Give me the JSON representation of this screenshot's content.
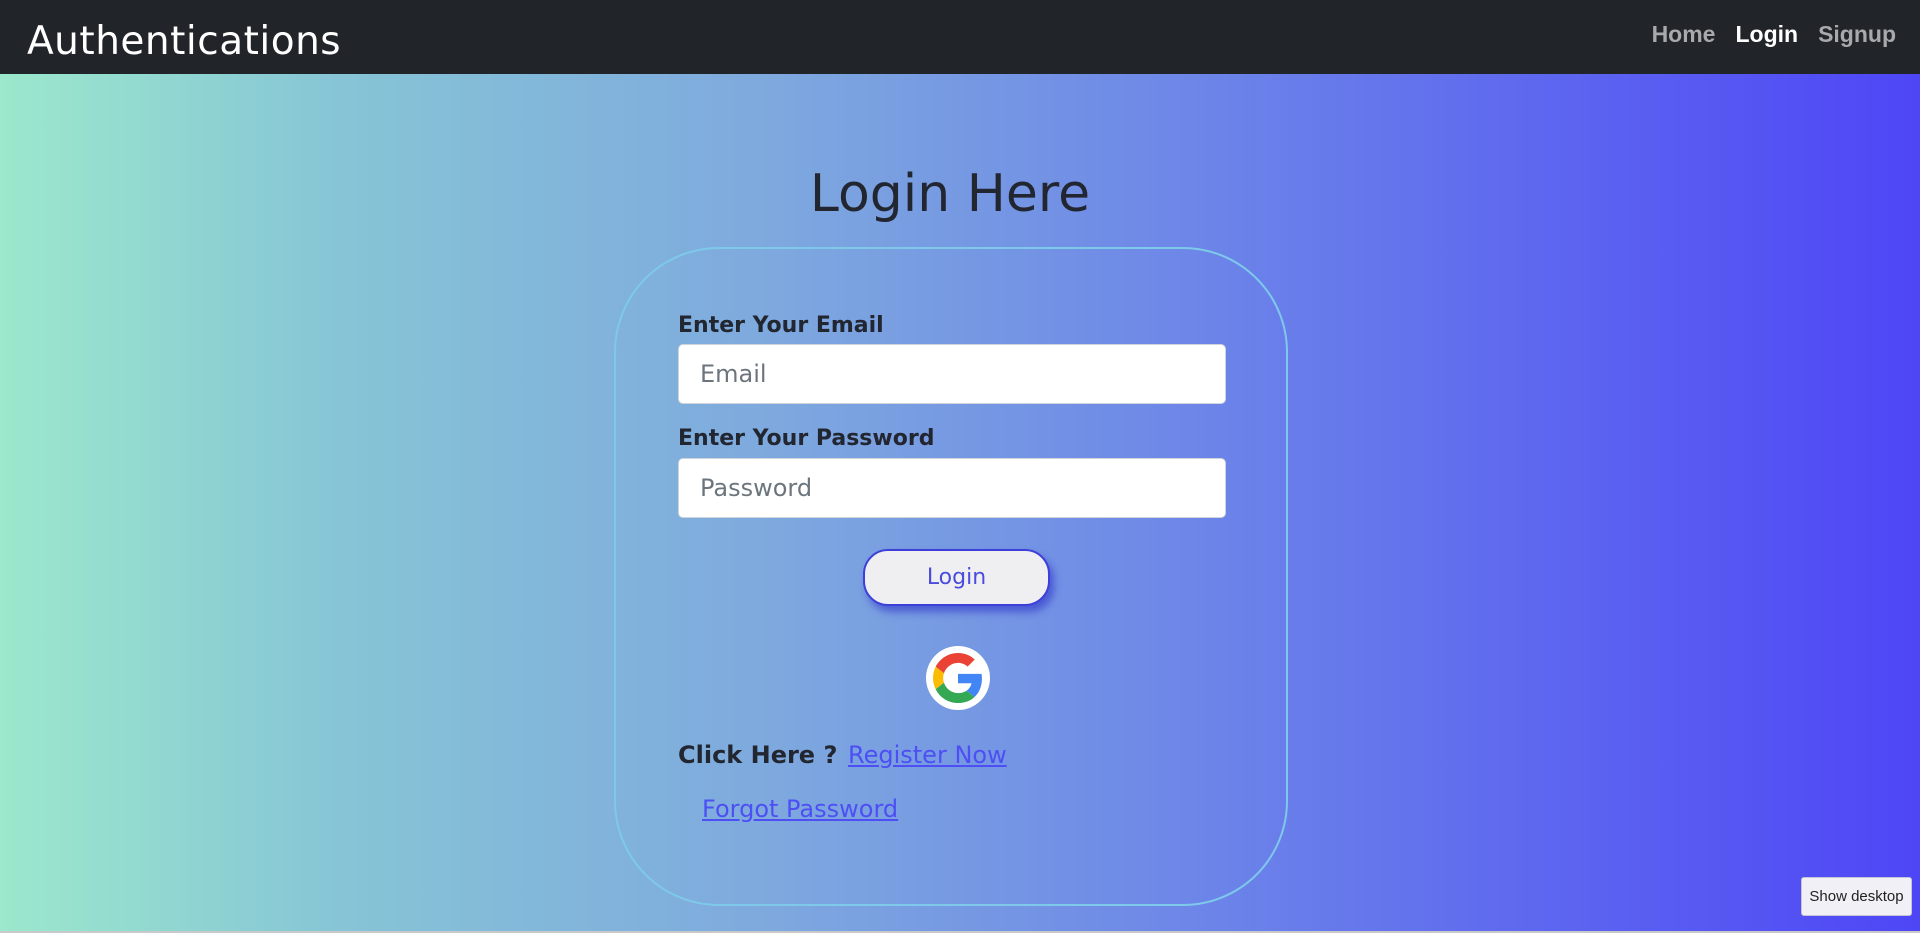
{
  "navbar": {
    "brand": "Authentications",
    "links": [
      {
        "label": "Home",
        "active": false
      },
      {
        "label": "Login",
        "active": true
      },
      {
        "label": "Signup",
        "active": false
      }
    ]
  },
  "page": {
    "title": "Login Here"
  },
  "form": {
    "email_label": "Enter Your Email",
    "email_placeholder": "Email",
    "email_value": "",
    "password_label": "Enter Your Password",
    "password_placeholder": "Password",
    "password_value": "",
    "login_button": "Login",
    "google_icon": "google-icon",
    "click_here_text": "Click Here ?",
    "register_link": "Register Now",
    "forgot_link": "Forgot Password"
  },
  "taskbar": {
    "show_desktop": "Show desktop"
  },
  "colors": {
    "navbar_bg": "#212429",
    "gradient_start": "#9be8cc",
    "gradient_end": "#4e46f6",
    "card_border": "#7ec9ea",
    "link": "#4d4ff4",
    "button_border": "#3d3fd8"
  }
}
